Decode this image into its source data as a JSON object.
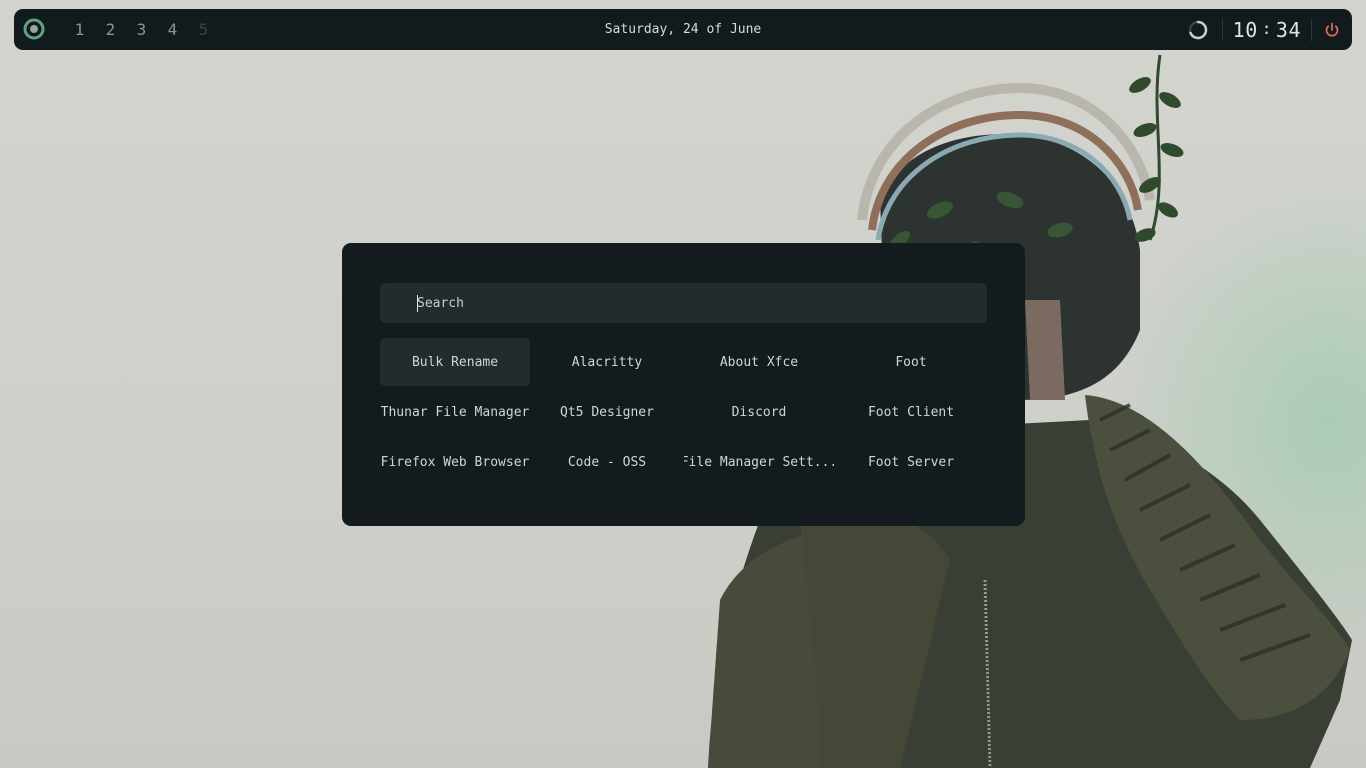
{
  "topbar": {
    "workspaces": [
      {
        "label": "1",
        "active": true
      },
      {
        "label": "2",
        "active": true
      },
      {
        "label": "3",
        "active": true
      },
      {
        "label": "4",
        "active": true
      },
      {
        "label": "5",
        "active": false
      }
    ],
    "date": "Saturday, 24 of June",
    "clock": {
      "hours": "10",
      "separator": ":",
      "minutes": "34"
    },
    "icons": {
      "logo": "logo-icon",
      "spinner": "loading-icon",
      "power": "power-icon"
    },
    "colors": {
      "accent": "#5fa37f",
      "power": "#e0665f",
      "bar": "#111a1d"
    }
  },
  "launcher": {
    "search": {
      "placeholder": "Search",
      "value": ""
    },
    "apps": [
      {
        "label": "Bulk Rename",
        "selected": true
      },
      {
        "label": "Alacritty"
      },
      {
        "label": "About Xfce"
      },
      {
        "label": "Foot"
      },
      {
        "label": "Thunar File Manager"
      },
      {
        "label": "Qt5 Designer"
      },
      {
        "label": "Discord"
      },
      {
        "label": "Foot Client"
      },
      {
        "label": "Firefox Web Browser"
      },
      {
        "label": "Code - OSS"
      },
      {
        "label": "File Manager Sett..."
      },
      {
        "label": "Foot Server"
      }
    ]
  }
}
